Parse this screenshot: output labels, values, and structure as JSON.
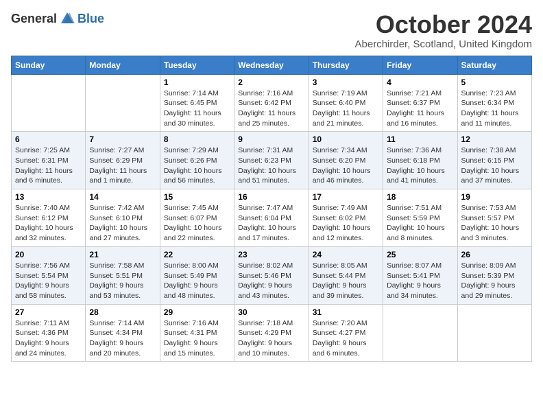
{
  "logo": {
    "general": "General",
    "blue": "Blue"
  },
  "title": "October 2024",
  "location": "Aberchirder, Scotland, United Kingdom",
  "headers": [
    "Sunday",
    "Monday",
    "Tuesday",
    "Wednesday",
    "Thursday",
    "Friday",
    "Saturday"
  ],
  "weeks": [
    [
      {
        "day": "",
        "detail": ""
      },
      {
        "day": "",
        "detail": ""
      },
      {
        "day": "1",
        "detail": "Sunrise: 7:14 AM\nSunset: 6:45 PM\nDaylight: 11 hours and 30 minutes."
      },
      {
        "day": "2",
        "detail": "Sunrise: 7:16 AM\nSunset: 6:42 PM\nDaylight: 11 hours and 25 minutes."
      },
      {
        "day": "3",
        "detail": "Sunrise: 7:19 AM\nSunset: 6:40 PM\nDaylight: 11 hours and 21 minutes."
      },
      {
        "day": "4",
        "detail": "Sunrise: 7:21 AM\nSunset: 6:37 PM\nDaylight: 11 hours and 16 minutes."
      },
      {
        "day": "5",
        "detail": "Sunrise: 7:23 AM\nSunset: 6:34 PM\nDaylight: 11 hours and 11 minutes."
      }
    ],
    [
      {
        "day": "6",
        "detail": "Sunrise: 7:25 AM\nSunset: 6:31 PM\nDaylight: 11 hours and 6 minutes."
      },
      {
        "day": "7",
        "detail": "Sunrise: 7:27 AM\nSunset: 6:29 PM\nDaylight: 11 hours and 1 minute."
      },
      {
        "day": "8",
        "detail": "Sunrise: 7:29 AM\nSunset: 6:26 PM\nDaylight: 10 hours and 56 minutes."
      },
      {
        "day": "9",
        "detail": "Sunrise: 7:31 AM\nSunset: 6:23 PM\nDaylight: 10 hours and 51 minutes."
      },
      {
        "day": "10",
        "detail": "Sunrise: 7:34 AM\nSunset: 6:20 PM\nDaylight: 10 hours and 46 minutes."
      },
      {
        "day": "11",
        "detail": "Sunrise: 7:36 AM\nSunset: 6:18 PM\nDaylight: 10 hours and 41 minutes."
      },
      {
        "day": "12",
        "detail": "Sunrise: 7:38 AM\nSunset: 6:15 PM\nDaylight: 10 hours and 37 minutes."
      }
    ],
    [
      {
        "day": "13",
        "detail": "Sunrise: 7:40 AM\nSunset: 6:12 PM\nDaylight: 10 hours and 32 minutes."
      },
      {
        "day": "14",
        "detail": "Sunrise: 7:42 AM\nSunset: 6:10 PM\nDaylight: 10 hours and 27 minutes."
      },
      {
        "day": "15",
        "detail": "Sunrise: 7:45 AM\nSunset: 6:07 PM\nDaylight: 10 hours and 22 minutes."
      },
      {
        "day": "16",
        "detail": "Sunrise: 7:47 AM\nSunset: 6:04 PM\nDaylight: 10 hours and 17 minutes."
      },
      {
        "day": "17",
        "detail": "Sunrise: 7:49 AM\nSunset: 6:02 PM\nDaylight: 10 hours and 12 minutes."
      },
      {
        "day": "18",
        "detail": "Sunrise: 7:51 AM\nSunset: 5:59 PM\nDaylight: 10 hours and 8 minutes."
      },
      {
        "day": "19",
        "detail": "Sunrise: 7:53 AM\nSunset: 5:57 PM\nDaylight: 10 hours and 3 minutes."
      }
    ],
    [
      {
        "day": "20",
        "detail": "Sunrise: 7:56 AM\nSunset: 5:54 PM\nDaylight: 9 hours and 58 minutes."
      },
      {
        "day": "21",
        "detail": "Sunrise: 7:58 AM\nSunset: 5:51 PM\nDaylight: 9 hours and 53 minutes."
      },
      {
        "day": "22",
        "detail": "Sunrise: 8:00 AM\nSunset: 5:49 PM\nDaylight: 9 hours and 48 minutes."
      },
      {
        "day": "23",
        "detail": "Sunrise: 8:02 AM\nSunset: 5:46 PM\nDaylight: 9 hours and 43 minutes."
      },
      {
        "day": "24",
        "detail": "Sunrise: 8:05 AM\nSunset: 5:44 PM\nDaylight: 9 hours and 39 minutes."
      },
      {
        "day": "25",
        "detail": "Sunrise: 8:07 AM\nSunset: 5:41 PM\nDaylight: 9 hours and 34 minutes."
      },
      {
        "day": "26",
        "detail": "Sunrise: 8:09 AM\nSunset: 5:39 PM\nDaylight: 9 hours and 29 minutes."
      }
    ],
    [
      {
        "day": "27",
        "detail": "Sunrise: 7:11 AM\nSunset: 4:36 PM\nDaylight: 9 hours and 24 minutes."
      },
      {
        "day": "28",
        "detail": "Sunrise: 7:14 AM\nSunset: 4:34 PM\nDaylight: 9 hours and 20 minutes."
      },
      {
        "day": "29",
        "detail": "Sunrise: 7:16 AM\nSunset: 4:31 PM\nDaylight: 9 hours and 15 minutes."
      },
      {
        "day": "30",
        "detail": "Sunrise: 7:18 AM\nSunset: 4:29 PM\nDaylight: 9 hours and 10 minutes."
      },
      {
        "day": "31",
        "detail": "Sunrise: 7:20 AM\nSunset: 4:27 PM\nDaylight: 9 hours and 6 minutes."
      },
      {
        "day": "",
        "detail": ""
      },
      {
        "day": "",
        "detail": ""
      }
    ]
  ]
}
